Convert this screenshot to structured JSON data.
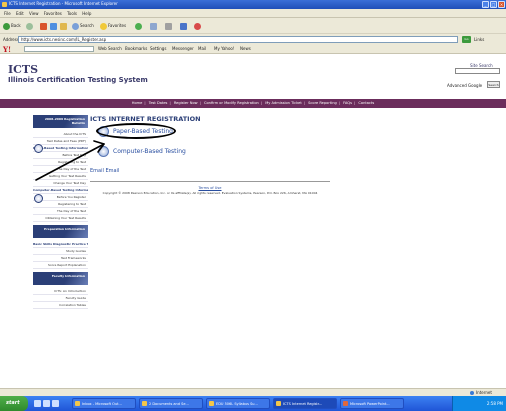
{
  "window": {
    "title": "ICTS Internet Registration - Microsoft Internet Explorer"
  },
  "menu": [
    "File",
    "Edit",
    "View",
    "Favorites",
    "Tools",
    "Help"
  ],
  "toolbar": {
    "back": "Back",
    "search": "Search",
    "favorites": "Favorites"
  },
  "address": {
    "label": "Address",
    "url": "http://www.icts.nesinc.com/IL_Register.asp",
    "go": "Go",
    "links": "Links"
  },
  "yahoo": {
    "logo": "Y!",
    "items": [
      "Web Search",
      "Bookmarks",
      "Settings",
      "Messenger",
      "Mail",
      "My Yahoo!",
      "News"
    ]
  },
  "site": {
    "logo": "ICTS",
    "name": "Illinois Certification Testing System",
    "site_search": "Site Search",
    "advanced": "Advanced Google",
    "go": "Search"
  },
  "topnav": [
    "Home",
    "Test Dates",
    "Register Now",
    "Confirm or Modify Registration",
    "My Admission Ticket",
    "Score Reporting",
    "FAQs",
    "Contacts"
  ],
  "sidebar": {
    "sections": [
      {
        "head": "2008–2009 Registration Bulletin",
        "items": [
          "About the ICTS",
          "Test Dates and Fees (PDF)",
          "Paper-Based Testing Information",
          "Before Test Day",
          "Registering to Test",
          "The Day of the Test",
          "Getting Your Test Results",
          "Change Your Test Day",
          "Computer-Based Testing Information",
          "Before You Register",
          "Registering to Test",
          "The Day of the Test",
          "Obtaining Your Test Results"
        ]
      },
      {
        "head": "Preparation Information",
        "items": [
          "Basic Skills Diagnostic Practice Test",
          "Study Guides",
          "Test Frameworks",
          "Score Report Explanation"
        ]
      },
      {
        "head": "Faculty Information",
        "items": [
          "ICTS: An Introduction",
          "Faculty Guide",
          "Correlation Tables"
        ]
      }
    ]
  },
  "main": {
    "title": "ICTS INTERNET REGISTRATION",
    "options": [
      "Paper-Based Testing",
      "Computer-Based Testing"
    ],
    "breadcrumb": "Email Email",
    "terms": "Terms of Use",
    "copyright": "Copyright © 2008 Pearson Education, Inc. or its affiliate(s). All rights reserved. Evaluation Systems, Pearson, P.O. Box 226, Amherst, MA 01004"
  },
  "status": {
    "zone": "Internet"
  },
  "taskbar": {
    "start": "start",
    "tasks": [
      "Inbox - Microsoft Out...",
      "2 Documents and Se...",
      "EDU 506L Syllabus Su...",
      "ICTS Internet Registr...",
      "Microsoft PowerPoint..."
    ],
    "clock": "2:58 PM"
  }
}
